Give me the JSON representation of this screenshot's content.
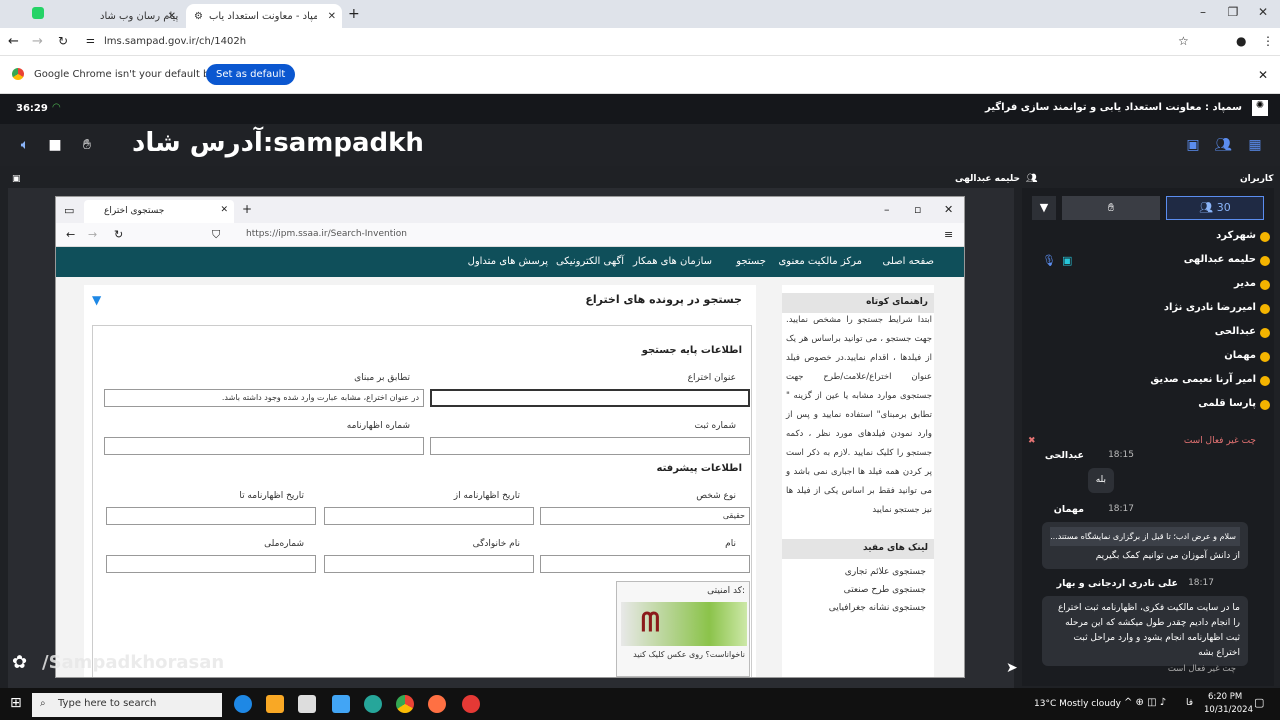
{
  "browser": {
    "tabs": [
      {
        "title": "پیام رسان وب شاد"
      },
      {
        "title": "سمپاد - معاونت استعداد یاب"
      }
    ],
    "url": "lms.sampad.gov.ir/ch/1402h",
    "default_prompt": "Google Chrome isn't your default browser",
    "set_default_label": "Set as default"
  },
  "app": {
    "time": "36:29",
    "title": "سمپاد : معاونت استعداد یابی و توانمند سازی فراگیر",
    "overlay_text": "آدرس شاد:sampadkh",
    "presenter_name": "حلیمه عبدالهی",
    "watermark": "/Sampadkhorasan"
  },
  "shared": {
    "tab_title": "جستجوی اختراع",
    "url": "https://ipm.ssaa.ir/Search-Invention",
    "nav": [
      "صفحه اصلی",
      "مرکز مالکیت معنوی",
      "جستجو",
      "سازمان های همکار",
      "آگهی الکترونیکی",
      "پرسش های متداول"
    ],
    "page_title": "جستجو در پرونده های اختراع",
    "basic_section": "اطلاعات پایه جستجو",
    "advanced_section": "اطلاعات پیشرفته",
    "labels": {
      "invention_title": "عنوان اختراع",
      "match_basis": "تطابق بر مبنای",
      "reg_no": "شماره ثبت",
      "declaration_no": "شماره اظهارنامه",
      "person_type": "نوع شخص",
      "decl_date_from": "تاریخ اظهارنامه از",
      "decl_date_to": "تاریخ اظهارنامه تا",
      "first_name": "نام",
      "last_name": "نام خانوادگی",
      "national_id": "شماره‌ملی",
      "captcha": "کد امنیتی:",
      "captcha_hint": "ناخواناست؟ روی عکس کلیک کنید"
    },
    "values": {
      "match_basis": "در عنوان اختراع، مشابه عبارت وارد شده وجود داشته باشد.",
      "person_type": "حقیقی"
    },
    "guide_title": "راهنمای کوتاه",
    "guide_text": "ابتدا شرایط جستجو را مشخص نمایید. جهت جستجو ، می توانید براساس هر یک از فیلدها ، اقدام نمایید.در خصوص فیلد عنوان اختراع/علامت/طرح جهت جستجوی موارد مشابه یا عین از گزینه \" تطابق برمبنای\" استفاده نمایید و پس از وارد نمودن فیلدهای مورد نظر ، دکمه جستجو را کلیک نمایید .لازم به ذکر است پر کردن همه فیلد ها اجباری نمی باشد و می توانید فقط بر اساس یکی از فیلد ها نیز جستجو نمایید",
    "links_title": "لینک های مفید",
    "links": [
      "جستجوی علائم تجاری",
      "جستجوی طرح صنعتی",
      "جستجوی نشانه جغرافیایی"
    ]
  },
  "users": {
    "header": "کاربران",
    "count": "30",
    "list": [
      "شهرکرد",
      "حلیمه عبدالهی",
      "مدیر",
      "امیررضا نادری نژاد",
      "عبدالحی",
      "مهمان",
      "امیر آرنا نعیمی صدیق",
      "پارسا قلمی"
    ]
  },
  "chat": {
    "header": "چت غیر فعال است",
    "footer": "چت غیر فعال است",
    "messages": [
      {
        "name": "عبدالحی",
        "time": "18:15",
        "text": "بله"
      },
      {
        "name": "مهمان",
        "time": "18:17",
        "quote": "سلام و عرض ادب؛ تا قبل از برگزاری نمایشگاه مستند...",
        "text": "از دانش آموزان می توانیم کمک بگیریم"
      },
      {
        "name": "علی نادری اردجانی و بهار",
        "time": "18:17",
        "text": "ما در سایت مالکیت فکری، اظهارنامه ثبت اختراع را انجام دادیم چقدر طول میکشه که این مرحله ثبت اظهارنامه انجام بشود و وارد مراحل ثبت اختراع بشه"
      }
    ]
  },
  "taskbar": {
    "search_placeholder": "Type here to search",
    "weather": "13°C  Mostly cloudy",
    "lang": "فا",
    "time": "6:20 PM",
    "date": "10/31/2024"
  },
  "colors": {
    "site_nav": "#0f4f5a",
    "chrome_blue": "#0b57d0",
    "user_badge": "#f4b400"
  }
}
